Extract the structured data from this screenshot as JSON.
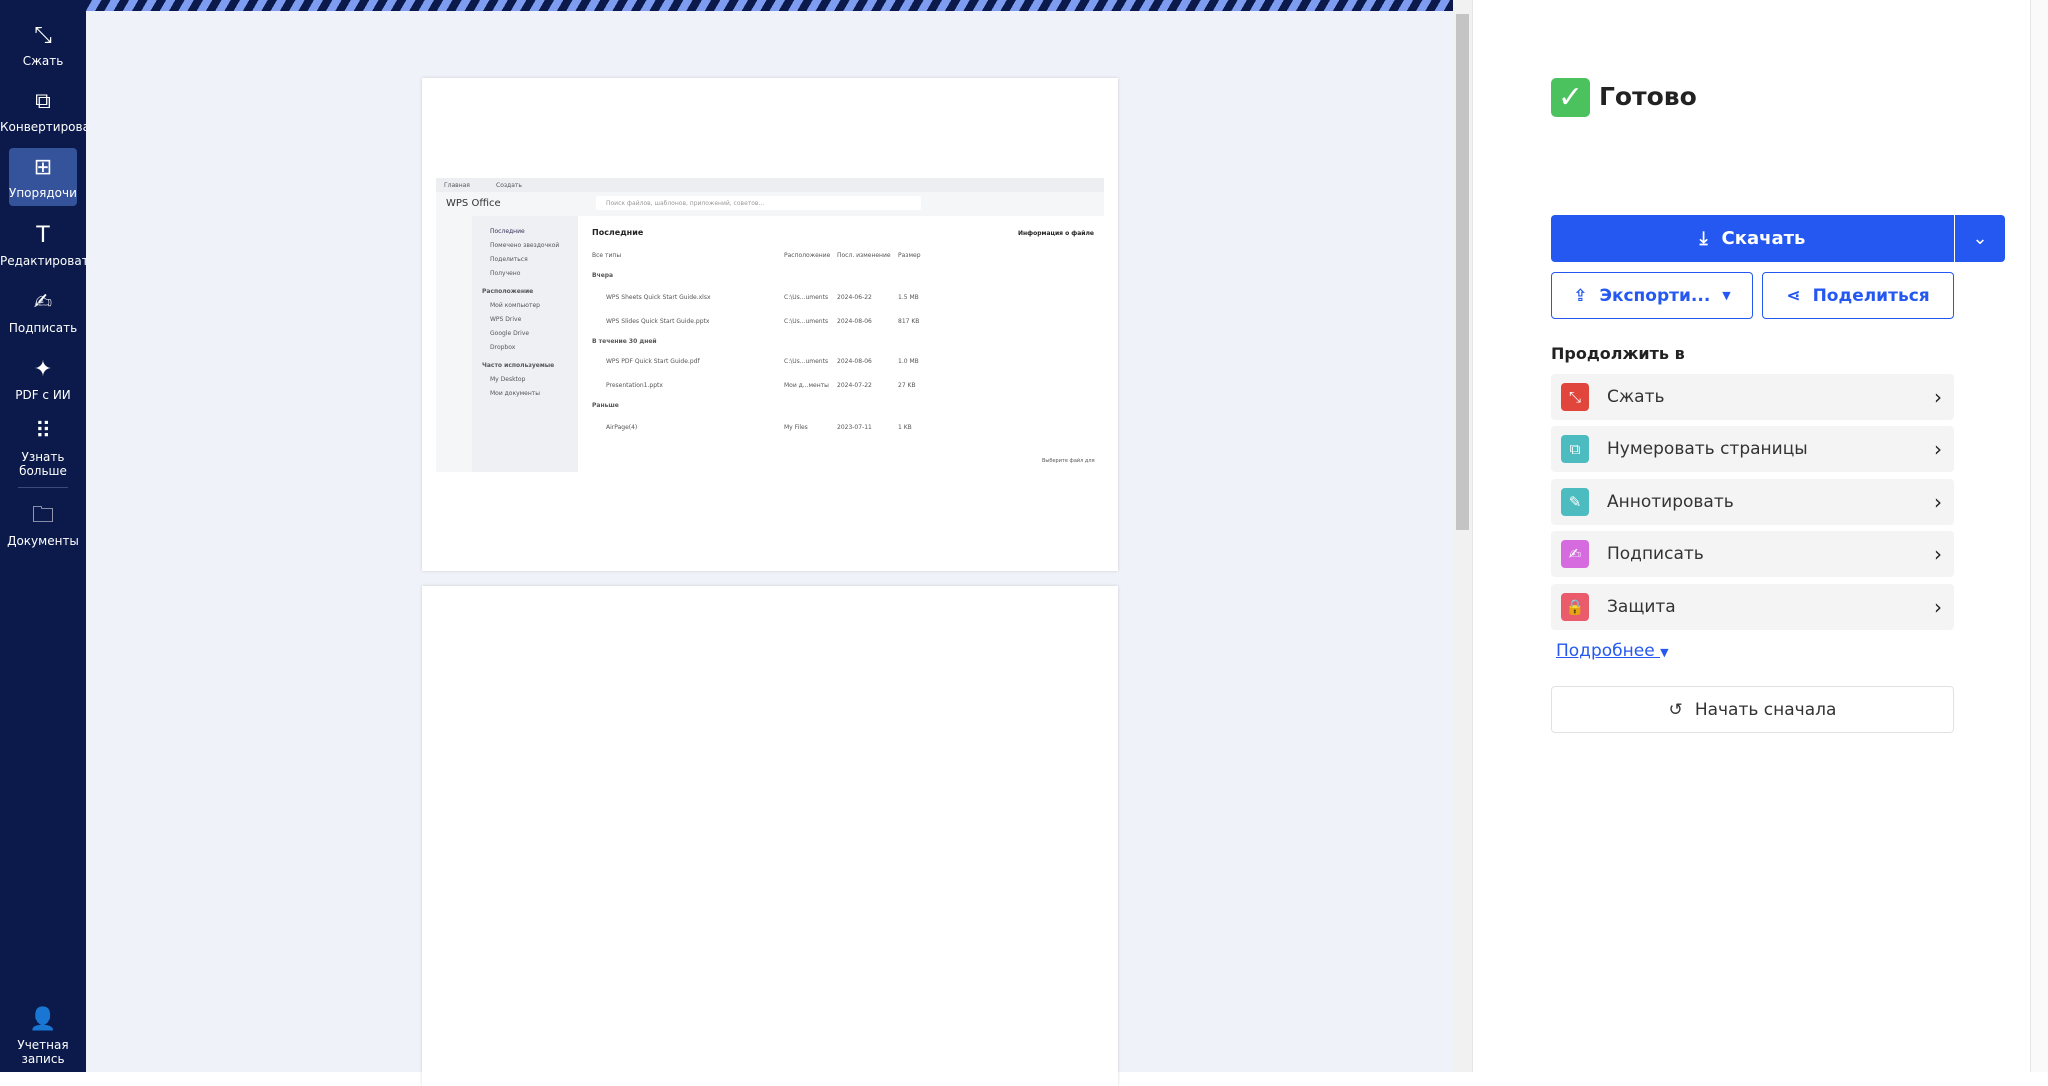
{
  "sidebar": {
    "items": [
      {
        "label": "Сжать",
        "icon": "compress-icon"
      },
      {
        "label": "Конвертировать",
        "icon": "convert-icon"
      },
      {
        "label": "Упорядочить",
        "icon": "organize-icon",
        "active": true
      },
      {
        "label": "Редактировать",
        "icon": "text-icon"
      },
      {
        "label": "Подписать",
        "icon": "signature-icon"
      },
      {
        "label": "PDF с ИИ",
        "icon": "sparkle-icon"
      },
      {
        "label": "Узнать больше",
        "icon": "grid-icon"
      },
      {
        "label": "Документы",
        "icon": "folder-icon"
      }
    ],
    "account": "Учетная запись"
  },
  "preview": {
    "tabs": [
      "Главная",
      "Создать"
    ],
    "app": "WPS Office",
    "search": "Поиск файлов, шаблонов, приложений, советов...",
    "nav": [
      "Последние",
      "Помечено звездочкой",
      "Поделиться",
      "Получено"
    ],
    "locations_title": "Расположение",
    "locations": [
      "Мой компьютер",
      "WPS Drive",
      "Google Drive",
      "Dropbox"
    ],
    "frequent_title": "Часто используемые",
    "frequent": [
      "My Desktop",
      "Мои документы"
    ],
    "heading": "Последние",
    "columns": [
      "Все типы",
      "Расположение",
      "Посл. изменение",
      "Размер"
    ],
    "groups": [
      {
        "title": "Вчера",
        "files": [
          [
            "WPS Sheets Quick Start Guide.xlsx",
            "C:\\Us...uments",
            "2024-06-22",
            "1.5 MB"
          ],
          [
            "WPS Slides Quick Start Guide.pptx",
            "C:\\Us...uments",
            "2024-08-06",
            "817 KB"
          ]
        ]
      },
      {
        "title": "В течение 30 дней",
        "files": [
          [
            "WPS PDF Quick Start Guide.pdf",
            "C:\\Us...uments",
            "2024-08-06",
            "1.0 MB"
          ],
          [
            "Presentation1.pptx",
            "Мои д...менты",
            "2024-07-22",
            "27 KB"
          ]
        ]
      },
      {
        "title": "Раньше",
        "files": [
          [
            "AirPage(4)",
            "My Files",
            "2023-07-11",
            "1 KB"
          ]
        ]
      }
    ],
    "info_title": "Информация о файле",
    "info_hint": "Выберите файл для"
  },
  "panel": {
    "status": "Готово",
    "download": "Скачать",
    "export": "Экспорти...",
    "share": "Поделиться",
    "continue_title": "Продолжить в",
    "tools": [
      {
        "label": "Сжать",
        "color": "#e0463c",
        "icon": "compress-icon"
      },
      {
        "label": "Нумеровать страницы",
        "color": "#4dbcc0",
        "icon": "page-numbers-icon"
      },
      {
        "label": "Аннотировать",
        "color": "#4dbcc0",
        "icon": "pencil-icon"
      },
      {
        "label": "Подписать",
        "color": "#d66be0",
        "icon": "signature-icon"
      },
      {
        "label": "Защита",
        "color": "#ea5b6b",
        "icon": "lock-icon"
      }
    ],
    "more": "Подробнее",
    "restart": "Начать сначала"
  }
}
